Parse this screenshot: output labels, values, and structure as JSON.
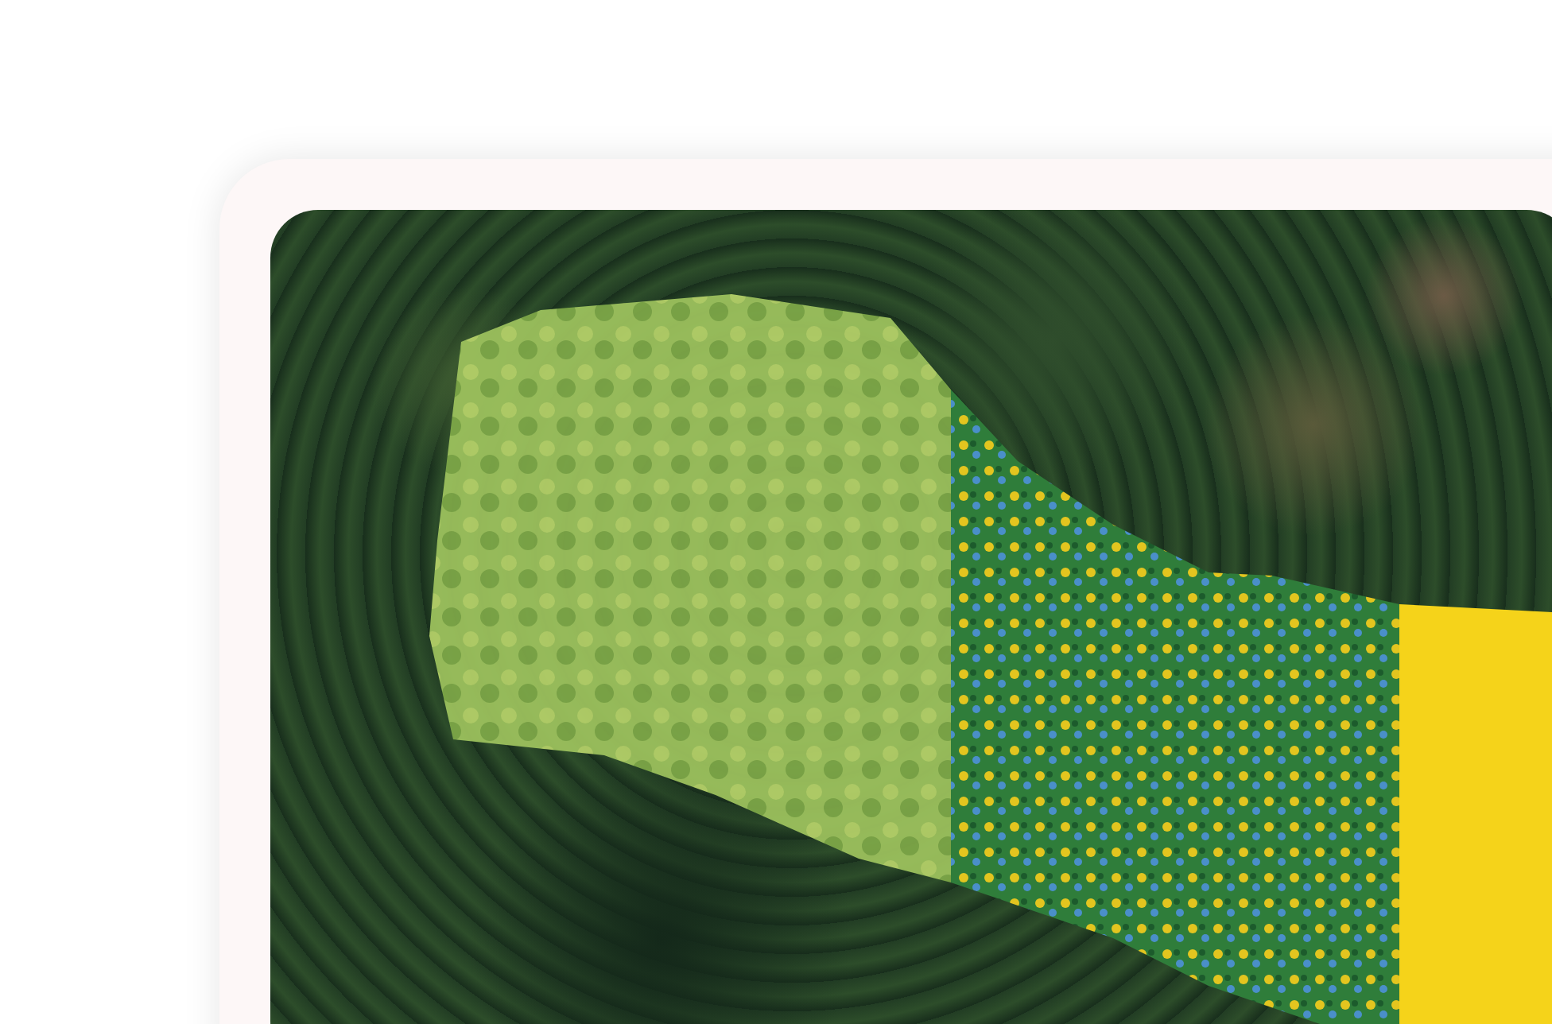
{
  "map": {
    "layers": [
      {
        "kind": "imagery"
      },
      {
        "kind": "classified"
      },
      {
        "kind": "index"
      }
    ]
  }
}
